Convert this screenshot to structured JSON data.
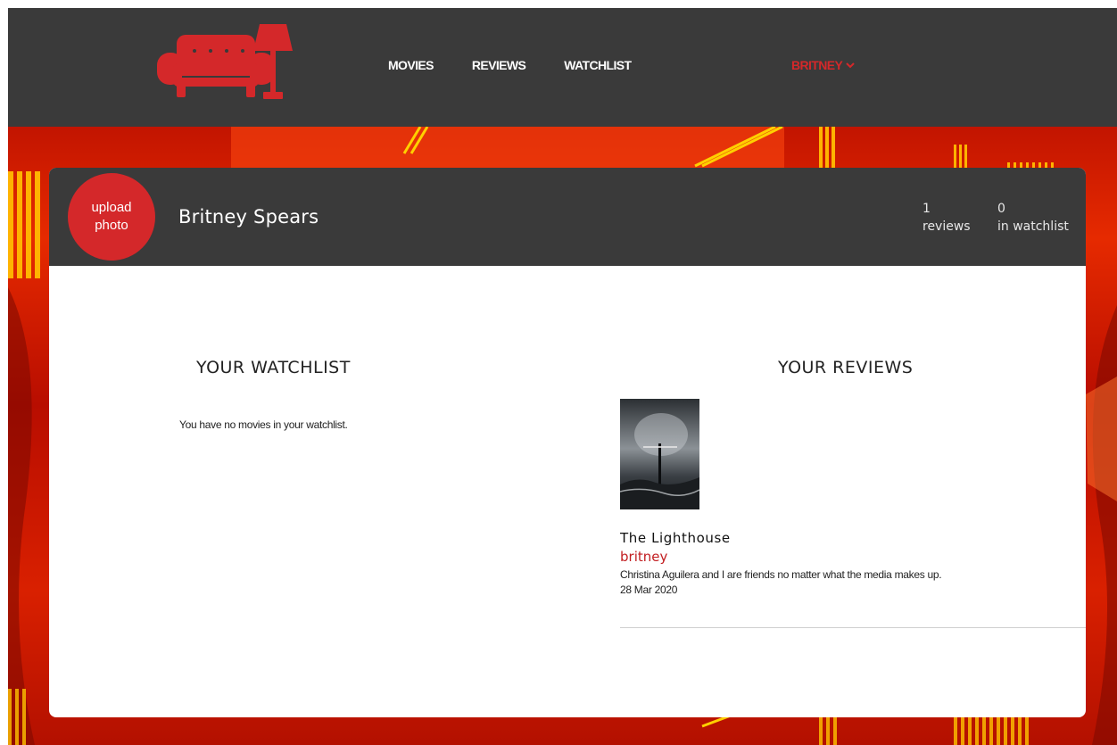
{
  "nav": {
    "links": [
      "MOVIES",
      "REVIEWS",
      "WATCHLIST"
    ],
    "user_label": "BRITNEY",
    "accent_color": "#d4282a",
    "logo_icon": "couch-lamp-icon"
  },
  "profile": {
    "avatar_label": "upload\nphoto",
    "name": "Britney Spears",
    "reviews_count": "1",
    "reviews_label": "reviews",
    "watchlist_count": "0",
    "watchlist_label": "in watchlist"
  },
  "watchlist": {
    "title": "YOUR WATCHLIST",
    "empty_message": "You have no movies in your watchlist."
  },
  "reviews": {
    "title": "YOUR REVIEWS",
    "items": [
      {
        "movie": "The Lighthouse",
        "user": "britney",
        "text": "Christina Aguilera and I are friends no matter what the media makes up.",
        "date": "28 Mar 2020"
      }
    ]
  }
}
